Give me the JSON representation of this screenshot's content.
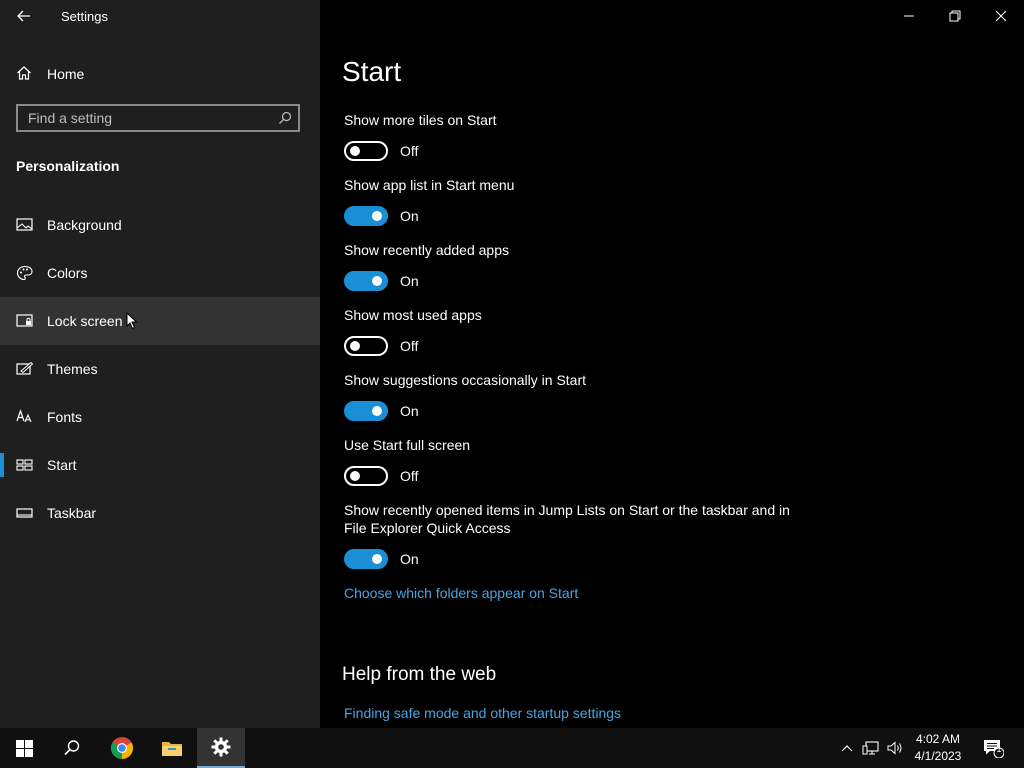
{
  "window": {
    "title": "Settings"
  },
  "sidebar": {
    "home_label": "Home",
    "search_placeholder": "Find a setting",
    "section_title": "Personalization",
    "items": [
      {
        "label": "Background",
        "icon": "image-icon"
      },
      {
        "label": "Colors",
        "icon": "palette-icon"
      },
      {
        "label": "Lock screen",
        "icon": "lock-screen-icon"
      },
      {
        "label": "Themes",
        "icon": "themes-icon"
      },
      {
        "label": "Fonts",
        "icon": "fonts-icon"
      },
      {
        "label": "Start",
        "icon": "start-icon"
      },
      {
        "label": "Taskbar",
        "icon": "taskbar-icon"
      }
    ],
    "selected": "Start",
    "hovered": "Lock screen"
  },
  "main": {
    "title": "Start",
    "settings": [
      {
        "label": "Show more tiles on Start",
        "state": "Off"
      },
      {
        "label": "Show app list in Start menu",
        "state": "On"
      },
      {
        "label": "Show recently added apps",
        "state": "On"
      },
      {
        "label": "Show most used apps",
        "state": "Off"
      },
      {
        "label": "Show suggestions occasionally in Start",
        "state": "On"
      },
      {
        "label": "Use Start full screen",
        "state": "Off"
      },
      {
        "label": "Show recently opened items in Jump Lists on Start or the taskbar and in File Explorer Quick Access",
        "state": "On"
      }
    ],
    "folders_link": "Choose which folders appear on Start",
    "help_title": "Help from the web",
    "help_link": "Finding safe mode and other startup settings"
  },
  "taskbar": {
    "time": "4:02 AM",
    "date": "4/1/2023",
    "notification_count": "1"
  },
  "colors": {
    "accent": "#1a8fd6",
    "link": "#4aa3e0",
    "sidebar_bg": "#1f1f1f"
  }
}
